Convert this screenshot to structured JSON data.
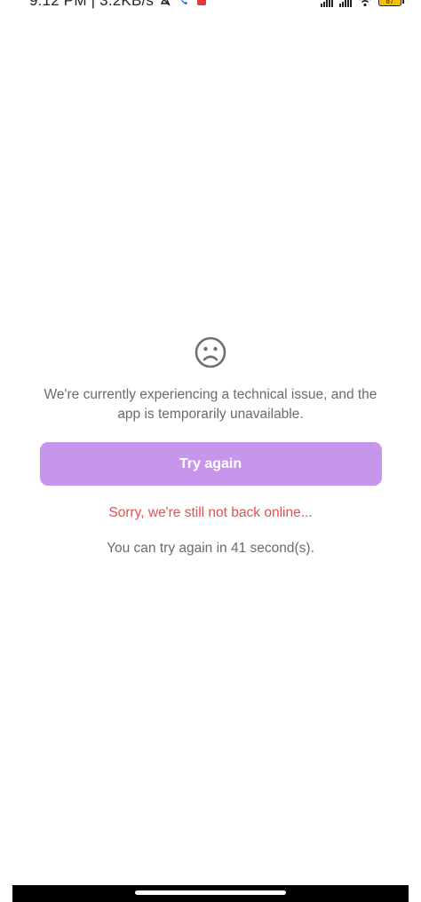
{
  "status_bar": {
    "time": "9:12 PM | 3.2KB/s",
    "battery_level": "87",
    "icons": [
      "mute-icon",
      "call-icon",
      "notification-icon",
      "signal-icon",
      "signal-icon",
      "wifi-icon",
      "battery-icon"
    ]
  },
  "error_screen": {
    "icon": "sad-face-icon",
    "message": "We're currently experiencing a technical issue, and the app is temporarily unavailable.",
    "retry_label": "Try again",
    "status_text": "Sorry, we're still not back online...",
    "countdown_text": "You can try again in 41 second(s)."
  },
  "colors": {
    "accent": "#c895ec",
    "error": "#e0524f",
    "text_muted": "#6b6b6b"
  }
}
